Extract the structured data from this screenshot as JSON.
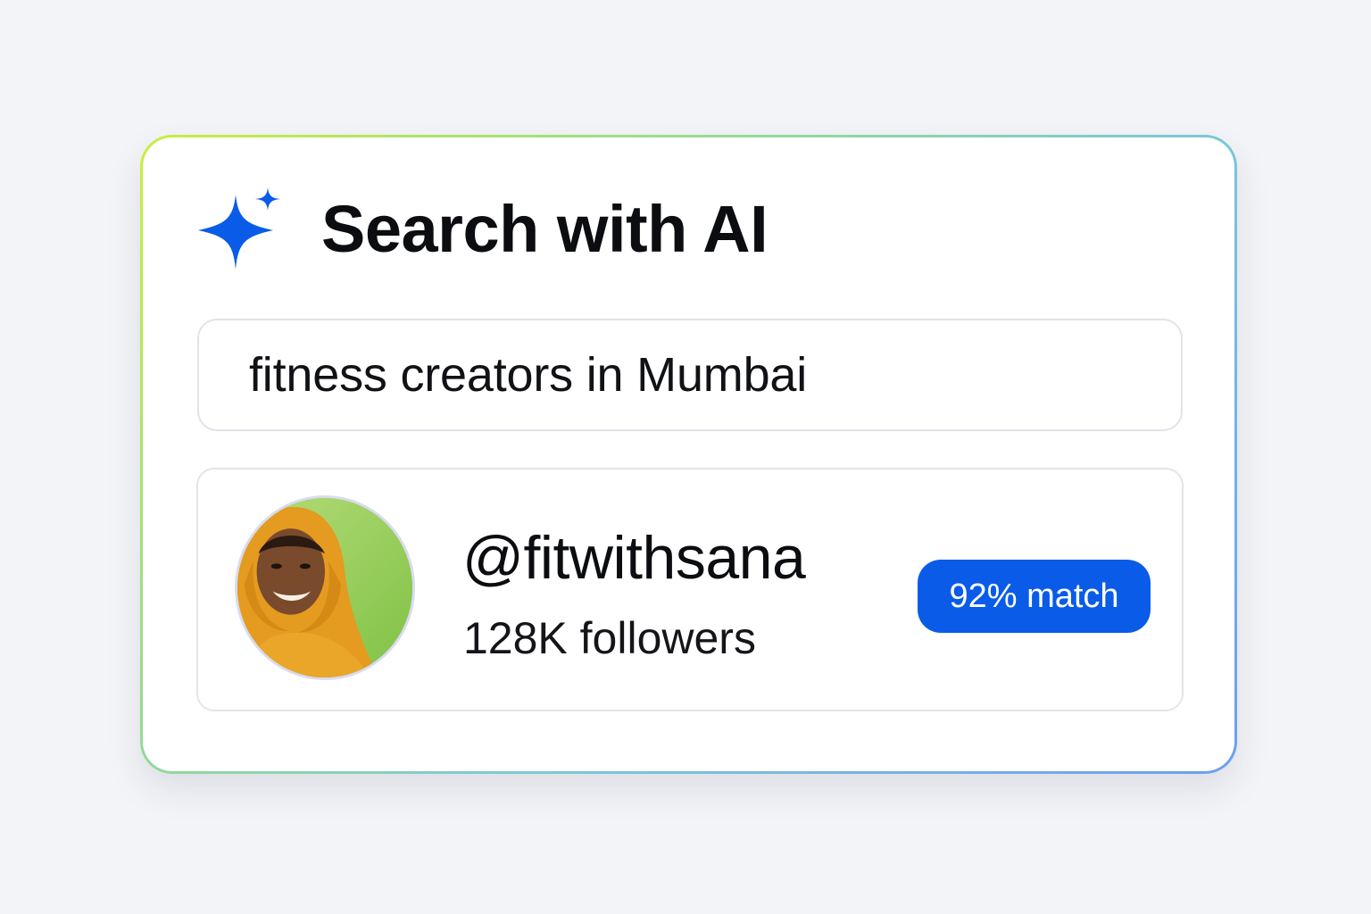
{
  "header": {
    "title": "Search with AI",
    "icon": "sparkle-icon"
  },
  "search": {
    "value": "fitness creators in Mumbai"
  },
  "result": {
    "handle": "@fitwithsana",
    "followers": "128K followers",
    "match": "92% match"
  },
  "colors": {
    "accent": "#0a5ce8",
    "border_gradient_start": "#c8ef3c",
    "border_gradient_end": "#6c9ef0"
  }
}
